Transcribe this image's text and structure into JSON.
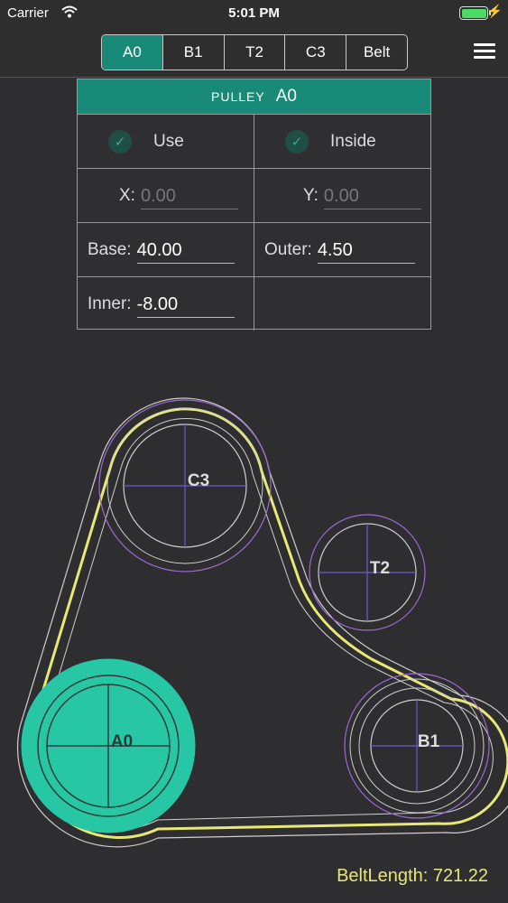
{
  "status": {
    "carrier": "Carrier",
    "time": "5:01 PM",
    "battery_level": 1.0,
    "wifi_icon": "wifi-icon",
    "charging_icon": "bolt-icon"
  },
  "nav": {
    "segments": [
      "A0",
      "B1",
      "T2",
      "C3",
      "Belt"
    ],
    "active_segment": "A0",
    "menu_icon": "hamburger-menu-icon"
  },
  "panel": {
    "header_label": "PULLEY",
    "header_value": "A0",
    "use_label": "Use",
    "inside_label": "Inside",
    "x_label": "X:",
    "x_value": "0.00",
    "y_label": "Y:",
    "y_value": "0.00",
    "base_label": "Base:",
    "base_value": "40.00",
    "outer_label": "Outer:",
    "outer_value": "4.50",
    "inner_label": "Inner:",
    "inner_value": "-8.00"
  },
  "drawing": {
    "pulleys": [
      {
        "name": "A0",
        "selected": true
      },
      {
        "name": "B1",
        "selected": false
      },
      {
        "name": "T2",
        "selected": false
      },
      {
        "name": "C3",
        "selected": false
      }
    ],
    "belt_length_text": "BeltLength: 721.22",
    "colors": {
      "selected_fill": "#27c7a6",
      "belt": "#e8e875",
      "outline": "#cfcfcf",
      "ring": "#9b6ad1",
      "crosshair": "#6a5acd",
      "accent": "#1a8a78"
    }
  }
}
